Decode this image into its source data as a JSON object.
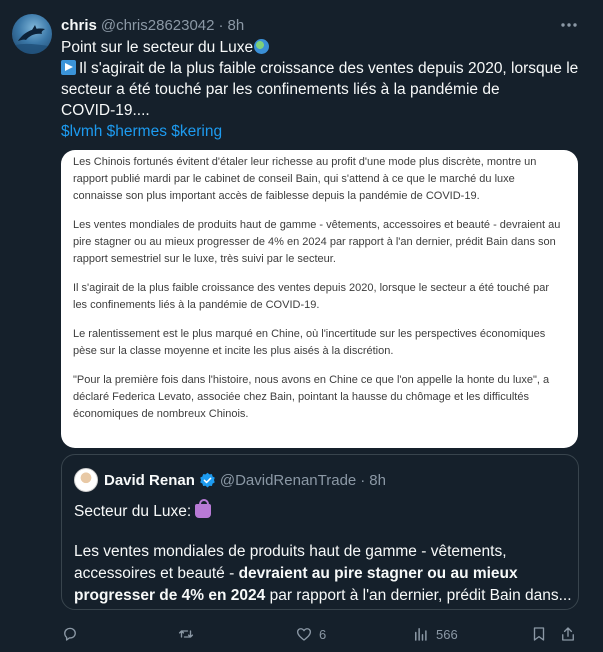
{
  "author": {
    "name": "chris",
    "handle": "@chris28623042",
    "separator": "·",
    "time": "8h"
  },
  "tweet": {
    "line1": "Point sur le secteur du Luxe",
    "line2": "Il s'agirait de la plus faible croissance des ventes depuis 2020, lorsque le",
    "line3": "secteur a été touché par les confinements liés à la pandémie de",
    "line4": "COVID-19....",
    "cashtags": "$lvmh $hermes $kering"
  },
  "image_text": {
    "p1": "Les Chinois fortunés évitent d'étaler leur richesse au profit d'une mode plus discrète, montre un rapport publié mardi par le cabinet de conseil Bain, qui s'attend à ce que le marché du luxe connaisse son plus important accès de faiblesse depuis la pandémie de COVID-19.",
    "p2": "Les ventes mondiales de produits haut de gamme - vêtements, accessoires et beauté - devraient au pire stagner ou au mieux progresser de 4% en 2024 par rapport à l'an dernier, prédit Bain dans son rapport semestriel sur le luxe, très suivi par le secteur.",
    "p3": "Il s'agirait de la plus faible croissance des ventes depuis 2020, lorsque le secteur a été touché par les confinements liés à la pandémie de COVID-19.",
    "p4": "Le ralentissement est le plus marqué en Chine, où l'incertitude sur les perspectives économiques pèse sur la classe moyenne et incite les plus aisés à la discrétion.",
    "p5": "\"Pour la première fois dans l'histoire, nous avons en Chine ce que l'on appelle la honte du luxe\", a déclaré Federica Levato, associée chez Bain, pointant la hausse du chômage et les difficultés économiques de nombreux Chinois."
  },
  "quote": {
    "name": "David Renan",
    "handle": "@DavidRenanTrade",
    "separator": "·",
    "time": "8h",
    "title": "Secteur du Luxe:",
    "line1": "Les ventes mondiales de produits haut de gamme - vêtements,",
    "line2_a": "accessoires et beauté - ",
    "line2_b": "devraient au pire stagner ou au mieux",
    "line3_a": "progresser de 4% en 2024",
    "line3_b": " par rapport à l'an dernier, prédit Bain dans..."
  },
  "actions": {
    "reply_count": "",
    "retweet_count": "",
    "like_count": "6",
    "views_count": "566"
  },
  "colors": {
    "background": "#15202b",
    "link": "#1d9bf0",
    "muted": "#8b98a5"
  }
}
